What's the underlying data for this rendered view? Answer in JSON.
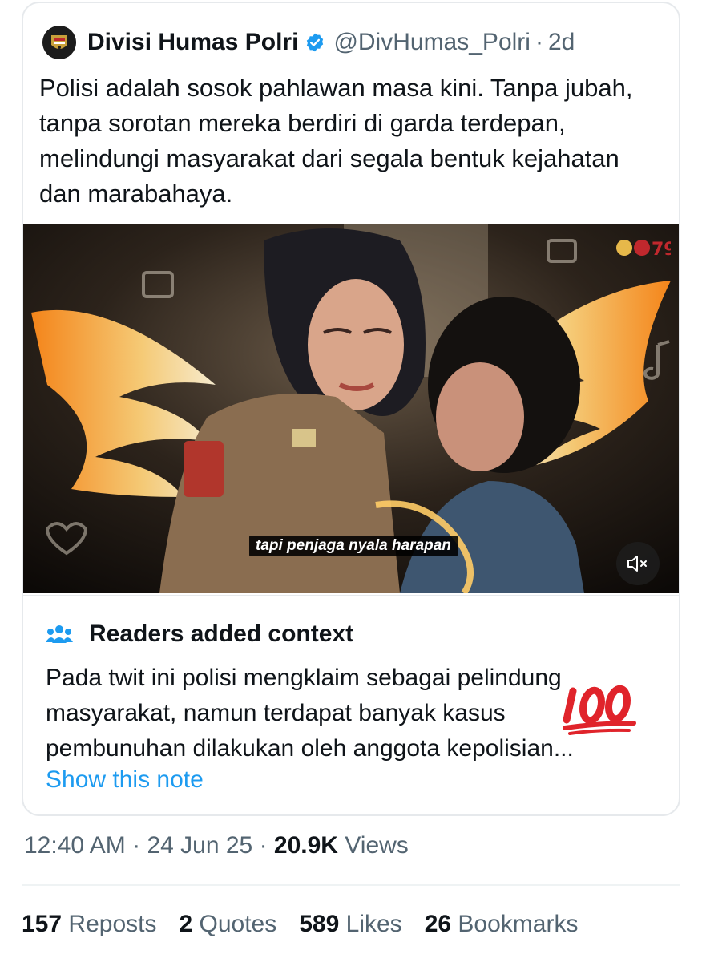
{
  "tweet": {
    "author_name": "Divisi Humas Polri",
    "handle": "@DivHumas_Polri",
    "separator": "·",
    "age": "2d",
    "text": "Polisi adalah sosok pahlawan masa kini. Tanpa jubah, tanpa sorotan mereka berdiri di garda terdepan, melindungi masyarakat dari segala bentuk kejahatan dan marabahaya.",
    "video_caption": "tapi penjaga nyala harapan",
    "video_muted": true
  },
  "context_note": {
    "title": "Readers added context",
    "body": "Pada twit ini polisi mengklaim sebagai pelindung masyarakat, namun terdapat banyak kasus pembunuhan dilakukan oleh anggota kepolisian...",
    "show_note_label": "Show this note",
    "emoji": "100-emoji"
  },
  "meta": {
    "time": "12:40 AM",
    "sep1": "·",
    "date": "24 Jun 25",
    "sep2": "·",
    "views_count": "20.9K",
    "views_label": "Views"
  },
  "stats": {
    "reposts_count": "157",
    "reposts_label": "Reposts",
    "quotes_count": "2",
    "quotes_label": "Quotes",
    "likes_count": "589",
    "likes_label": "Likes",
    "bookmarks_count": "26",
    "bookmarks_label": "Bookmarks"
  },
  "colors": {
    "link_blue": "#1d9bf0",
    "secondary_text": "#536471",
    "verified_blue": "#1d9bf0",
    "emoji_red": "#e0242b"
  }
}
